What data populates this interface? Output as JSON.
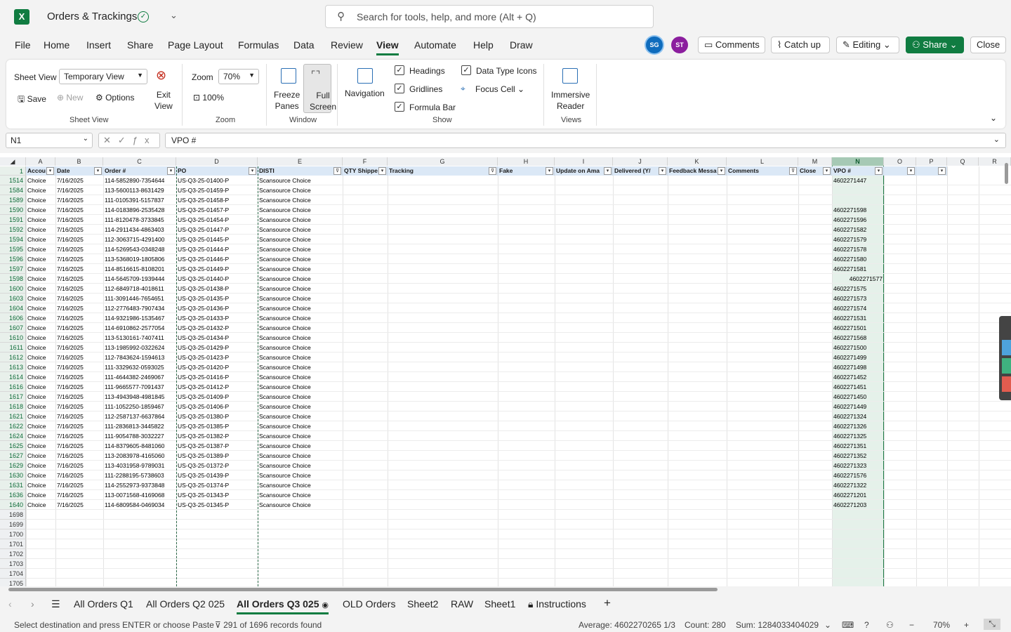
{
  "app": {
    "title": "Orders & Trackings",
    "search_placeholder": "Search for tools, help, and more (Alt + Q)"
  },
  "menu": [
    "File",
    "Home",
    "Insert",
    "Share",
    "Page Layout",
    "Formulas",
    "Data",
    "Review",
    "View",
    "Automate",
    "Help",
    "Draw"
  ],
  "active_menu": "View",
  "avatars": [
    {
      "initials": "SG",
      "color": "#0f6cbd"
    },
    {
      "initials": "ST",
      "color": "#8b1e9e"
    }
  ],
  "header_buttons": {
    "comments": "Comments",
    "catchup": "Catch up",
    "editing": "Editing",
    "share": "Share",
    "close": "Close"
  },
  "ribbon": {
    "sheet_view_label": "Sheet View",
    "sheet_view_value": "Temporary View",
    "save": "Save",
    "new": "New",
    "options": "Options",
    "exit_view": "Exit\nView",
    "sheet_view_group": "Sheet View",
    "zoom_label": "Zoom",
    "zoom_value": "70%",
    "zoom_100": "100%",
    "zoom_group": "Zoom",
    "freeze_panes": "Freeze\nPanes",
    "full_screen": "Full\nScreen",
    "window_group": "Window",
    "navigation": "Navigation",
    "headings": "Headings",
    "gridlines": "Gridlines",
    "formula_bar": "Formula Bar",
    "data_type_icons": "Data Type Icons",
    "focus_cell": "Focus Cell",
    "show_group": "Show",
    "immersive_reader": "Immersive\nReader",
    "views_group": "Views"
  },
  "formula_bar": {
    "name_box": "N1",
    "content": "VPO #"
  },
  "columns": [
    "A",
    "B",
    "C",
    "D",
    "E",
    "F",
    "G",
    "H",
    "I",
    "J",
    "K",
    "L",
    "M",
    "N",
    "O",
    "P",
    "Q",
    "R"
  ],
  "selected_column": "N",
  "headers": [
    "Accou",
    "Date",
    "Order #",
    "PO",
    "DISTI",
    "QTY Shippe",
    "Tracking",
    "Fake",
    "Update on Ama",
    "Delivered (Y/",
    "Feedback Messa",
    "Comments",
    "Close",
    "VPO #",
    "",
    ""
  ],
  "rows": [
    {
      "r": "1514",
      "a": "Choice",
      "b": "7/16/2025",
      "c": "114-5852890-7354644",
      "d": "US-Q3-25-01400-P",
      "e": "Scansource Choice",
      "n": "4602271447"
    },
    {
      "r": "1584",
      "a": "Choice",
      "b": "7/16/2025",
      "c": "113-5600113-8631429",
      "d": "US-Q3-25-01459-P",
      "e": "Scansource Choice",
      "n": ""
    },
    {
      "r": "1589",
      "a": "Choice",
      "b": "7/16/2025",
      "c": "111-0105391-5157837",
      "d": "US-Q3-25-01458-P",
      "e": "Scansource Choice",
      "n": ""
    },
    {
      "r": "1590",
      "a": "Choice",
      "b": "7/16/2025",
      "c": "114-0183896-2535428",
      "d": "US-Q3-25-01457-P",
      "e": "Scansource Choice",
      "n": "4602271598"
    },
    {
      "r": "1591",
      "a": "Choice",
      "b": "7/16/2025",
      "c": "111-8120478-3733845",
      "d": "US-Q3-25-01454-P",
      "e": "Scansource Choice",
      "n": "4602271596"
    },
    {
      "r": "1592",
      "a": "Choice",
      "b": "7/16/2025",
      "c": "114-2911434-4863403",
      "d": "US-Q3-25-01447-P",
      "e": "Scansource Choice",
      "n": "4602271582"
    },
    {
      "r": "1594",
      "a": "Choice",
      "b": "7/16/2025",
      "c": "112-3063715-4291400",
      "d": "US-Q3-25-01445-P",
      "e": "Scansource Choice",
      "n": "4602271579"
    },
    {
      "r": "1595",
      "a": "Choice",
      "b": "7/16/2025",
      "c": "114-5269543-0348248",
      "d": "US-Q3-25-01444-P",
      "e": "Scansource Choice",
      "n": "4602271578"
    },
    {
      "r": "1596",
      "a": "Choice",
      "b": "7/16/2025",
      "c": "113-5368019-1805806",
      "d": "US-Q3-25-01446-P",
      "e": "Scansource Choice",
      "n": "4602271580"
    },
    {
      "r": "1597",
      "a": "Choice",
      "b": "7/16/2025",
      "c": "114-8516615-8108201",
      "d": "US-Q3-25-01449-P",
      "e": "Scansource Choice",
      "n": "4602271581"
    },
    {
      "r": "1598",
      "a": "Choice",
      "b": "7/16/2025",
      "c": "114-5645709-1939444",
      "d": "US-Q3-25-01440-P",
      "e": "Scansource Choice",
      "n": "4602271577"
    },
    {
      "r": "1600",
      "a": "Choice",
      "b": "7/16/2025",
      "c": "112-6849718-4018611",
      "d": "US-Q3-25-01438-P",
      "e": "Scansource Choice",
      "n": "4602271575"
    },
    {
      "r": "1603",
      "a": "Choice",
      "b": "7/16/2025",
      "c": "111-3091446-7654651",
      "d": "US-Q3-25-01435-P",
      "e": "Scansource Choice",
      "n": "4602271573"
    },
    {
      "r": "1604",
      "a": "Choice",
      "b": "7/16/2025",
      "c": "112-2776483-7907434",
      "d": "US-Q3-25-01436-P",
      "e": "Scansource Choice",
      "n": "4602271574"
    },
    {
      "r": "1606",
      "a": "Choice",
      "b": "7/16/2025",
      "c": "114-9321986-1535467",
      "d": "US-Q3-25-01433-P",
      "e": "Scansource Choice",
      "n": "4602271531"
    },
    {
      "r": "1607",
      "a": "Choice",
      "b": "7/16/2025",
      "c": "114-6910862-2577054",
      "d": "US-Q3-25-01432-P",
      "e": "Scansource Choice",
      "n": "4602271501"
    },
    {
      "r": "1610",
      "a": "Choice",
      "b": "7/16/2025",
      "c": "113-5130161-7407411",
      "d": "US-Q3-25-01434-P",
      "e": "Scansource Choice",
      "n": "4602271568"
    },
    {
      "r": "1611",
      "a": "Choice",
      "b": "7/16/2025",
      "c": "113-1985992-0322624",
      "d": "US-Q3-25-01429-P",
      "e": "Scansource Choice",
      "n": "4602271500"
    },
    {
      "r": "1612",
      "a": "Choice",
      "b": "7/16/2025",
      "c": "112-7843624-1594613",
      "d": "US-Q3-25-01423-P",
      "e": "Scansource Choice",
      "n": "4602271499"
    },
    {
      "r": "1613",
      "a": "Choice",
      "b": "7/16/2025",
      "c": "111-3329632-0593025",
      "d": "US-Q3-25-01420-P",
      "e": "Scansource Choice",
      "n": "4602271498"
    },
    {
      "r": "1614",
      "a": "Choice",
      "b": "7/16/2025",
      "c": "111-4644382-2469067",
      "d": "US-Q3-25-01416-P",
      "e": "Scansource Choice",
      "n": "4602271452"
    },
    {
      "r": "1616",
      "a": "Choice",
      "b": "7/16/2025",
      "c": "111-9665577-7091437",
      "d": "US-Q3-25-01412-P",
      "e": "Scansource Choice",
      "n": "4602271451"
    },
    {
      "r": "1617",
      "a": "Choice",
      "b": "7/16/2025",
      "c": "113-4943948-4981845",
      "d": "US-Q3-25-01409-P",
      "e": "Scansource Choice",
      "n": "4602271450"
    },
    {
      "r": "1618",
      "a": "Choice",
      "b": "7/16/2025",
      "c": "111-1052250-1859467",
      "d": "US-Q3-25-01406-P",
      "e": "Scansource Choice",
      "n": "4602271449"
    },
    {
      "r": "1621",
      "a": "Choice",
      "b": "7/16/2025",
      "c": "112-2587137-6637864",
      "d": "US-Q3-25-01380-P",
      "e": "Scansource Choice",
      "n": "4602271324"
    },
    {
      "r": "1622",
      "a": "Choice",
      "b": "7/16/2025",
      "c": "111-2836813-3445822",
      "d": "US-Q3-25-01385-P",
      "e": "Scansource Choice",
      "n": "4602271326"
    },
    {
      "r": "1624",
      "a": "Choice",
      "b": "7/16/2025",
      "c": "111-9054788-3032227",
      "d": "US-Q3-25-01382-P",
      "e": "Scansource Choice",
      "n": "4602271325"
    },
    {
      "r": "1625",
      "a": "Choice",
      "b": "7/16/2025",
      "c": "114-8379605-8481060",
      "d": "US-Q3-25-01387-P",
      "e": "Scansource Choice",
      "n": "4602271351"
    },
    {
      "r": "1627",
      "a": "Choice",
      "b": "7/16/2025",
      "c": "113-2083978-4165060",
      "d": "US-Q3-25-01389-P",
      "e": "Scansource Choice",
      "n": "4602271352"
    },
    {
      "r": "1629",
      "a": "Choice",
      "b": "7/16/2025",
      "c": "113-4031958-9789031",
      "d": "US-Q3-25-01372-P",
      "e": "Scansource Choice",
      "n": "4602271323"
    },
    {
      "r": "1630",
      "a": "Choice",
      "b": "7/16/2025",
      "c": "111-2288195-5738603",
      "d": "US-Q3-25-01439-P",
      "e": "Scansource Choice",
      "n": "4602271576"
    },
    {
      "r": "1631",
      "a": "Choice",
      "b": "7/16/2025",
      "c": "114-2552973-9373848",
      "d": "US-Q3-25-01374-P",
      "e": "Scansource Choice",
      "n": "4602271322"
    },
    {
      "r": "1636",
      "a": "Choice",
      "b": "7/16/2025",
      "c": "113-0071568-4169068",
      "d": "US-Q3-25-01343-P",
      "e": "Scansource Choice",
      "n": "4602271201"
    },
    {
      "r": "1640",
      "a": "Choice",
      "b": "7/16/2025",
      "c": "114-6809584-0469034",
      "d": "US-Q3-25-01345-P",
      "e": "Scansource Choice",
      "n": "4602271203"
    },
    {
      "r": "1698",
      "a": "",
      "b": "",
      "c": "",
      "d": "",
      "e": "",
      "n": ""
    },
    {
      "r": "1699",
      "a": "",
      "b": "",
      "c": "",
      "d": "",
      "e": "",
      "n": ""
    },
    {
      "r": "1700",
      "a": "",
      "b": "",
      "c": "",
      "d": "",
      "e": "",
      "n": ""
    },
    {
      "r": "1701",
      "a": "",
      "b": "",
      "c": "",
      "d": "",
      "e": "",
      "n": ""
    },
    {
      "r": "1702",
      "a": "",
      "b": "",
      "c": "",
      "d": "",
      "e": "",
      "n": ""
    },
    {
      "r": "1703",
      "a": "",
      "b": "",
      "c": "",
      "d": "",
      "e": "",
      "n": ""
    },
    {
      "r": "1704",
      "a": "",
      "b": "",
      "c": "",
      "d": "",
      "e": "",
      "n": ""
    },
    {
      "r": "1705",
      "a": "",
      "b": "",
      "c": "",
      "d": "",
      "e": "",
      "n": ""
    }
  ],
  "tabs": [
    "All Orders Q1",
    "All Orders Q2 025",
    "All Orders Q3 025",
    "OLD Orders",
    "Sheet2",
    "RAW",
    "Sheet1",
    "Instructions"
  ],
  "active_tab": "All Orders Q3 025",
  "status": {
    "message": "Select destination and press ENTER or choose Paste",
    "records": "291 of 1696 records found",
    "average": "Average: 4602270265 1/3",
    "count": "Count: 280",
    "sum": "Sum: 1284033404029",
    "zoom": "70%"
  },
  "colors": {
    "accent": "#107c41",
    "header_fill": "#dbe8f6"
  }
}
